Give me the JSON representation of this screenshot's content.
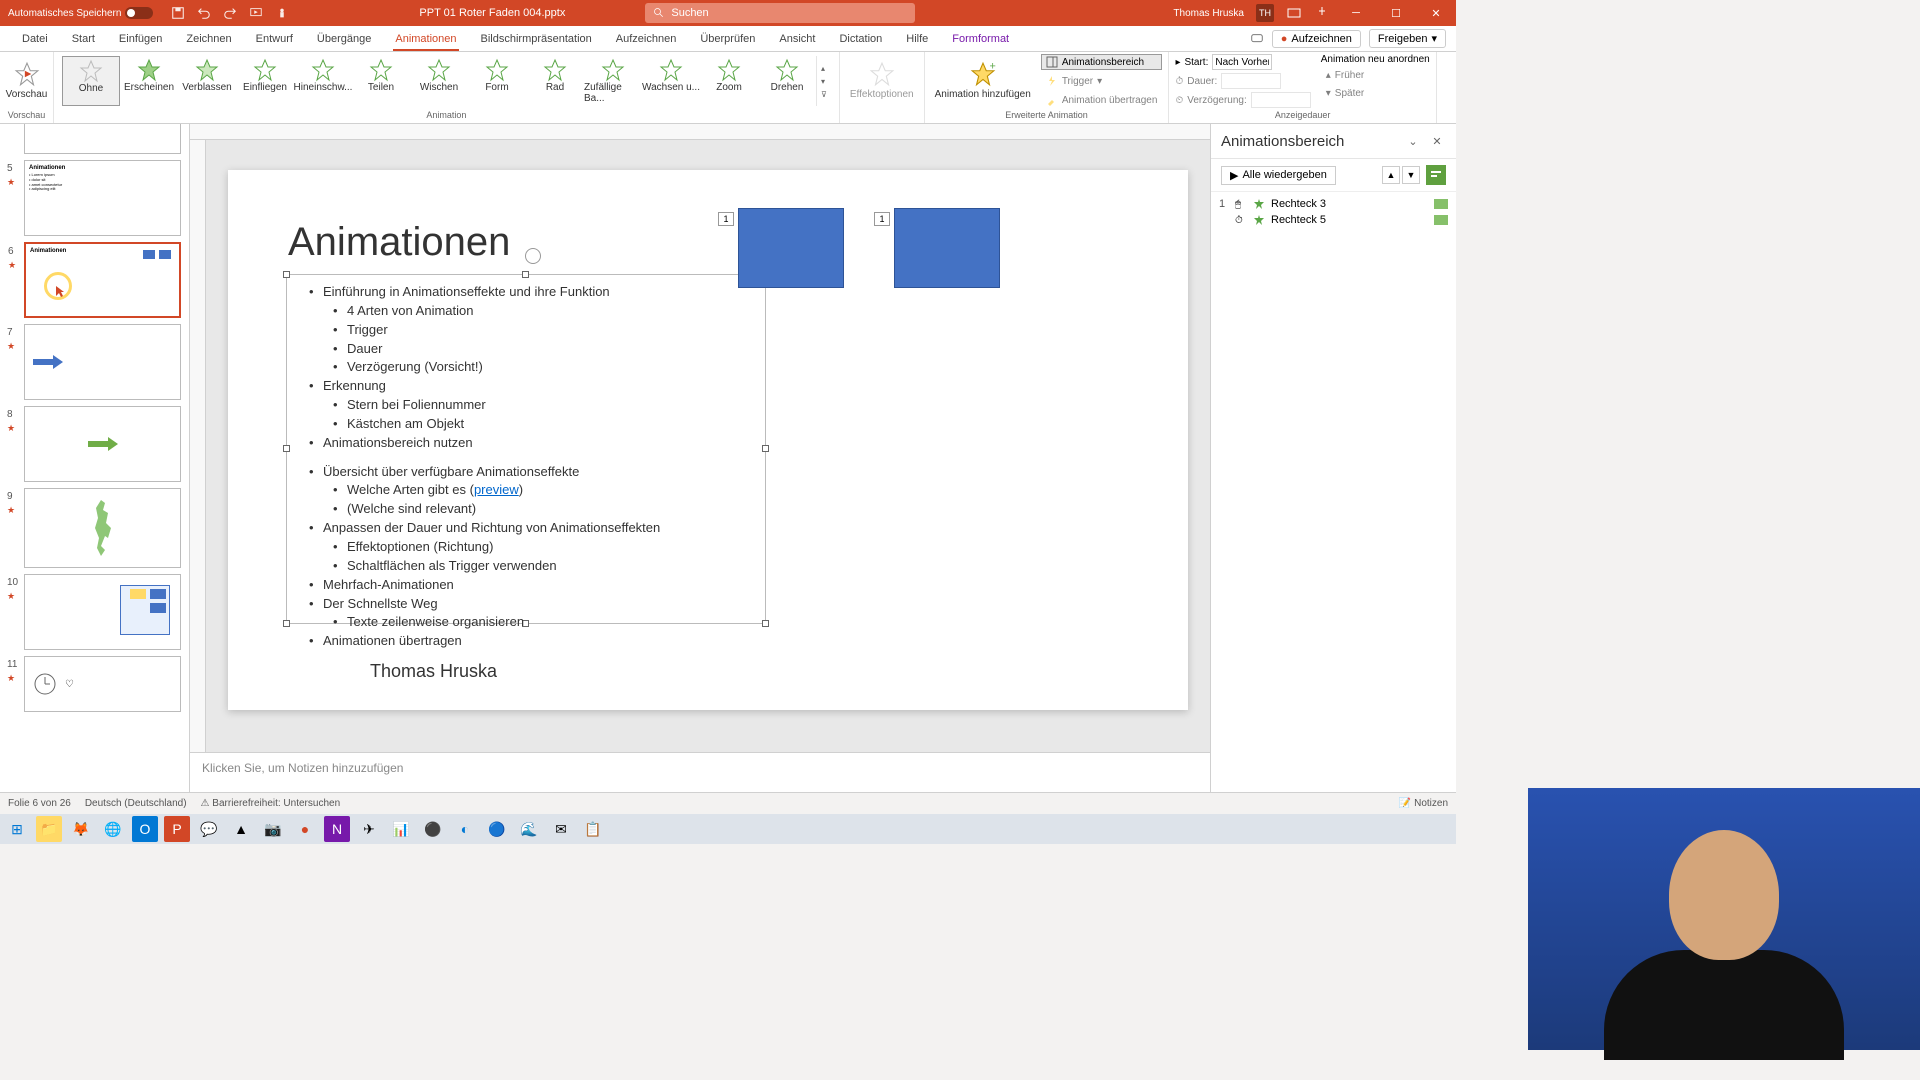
{
  "titlebar": {
    "autosave_label": "Automatisches Speichern",
    "filename": "PPT 01 Roter Faden 004.pptx",
    "search_placeholder": "Suchen",
    "user": "Thomas Hruska",
    "user_initials": "TH"
  },
  "tabs": {
    "datei": "Datei",
    "start": "Start",
    "einfuegen": "Einfügen",
    "zeichnen": "Zeichnen",
    "entwurf": "Entwurf",
    "uebergaenge": "Übergänge",
    "animationen": "Animationen",
    "bildschirm": "Bildschirmpräsentation",
    "aufzeichnen": "Aufzeichnen",
    "ueberpruefen": "Überprüfen",
    "ansicht": "Ansicht",
    "dictation": "Dictation",
    "hilfe": "Hilfe",
    "formformat": "Formformat",
    "record_btn": "Aufzeichnen",
    "share_btn": "Freigeben"
  },
  "ribbon": {
    "vorschau": "Vorschau",
    "vorschau_group": "Vorschau",
    "animations": [
      "Ohne",
      "Erscheinen",
      "Verblassen",
      "Einfliegen",
      "Hineinschw...",
      "Teilen",
      "Wischen",
      "Form",
      "Rad",
      "Zufällige Ba...",
      "Wachsen u...",
      "Zoom",
      "Drehen"
    ],
    "animation_group": "Animation",
    "effektoptionen": "Effektoptionen",
    "hinzufuegen": "Animation hinzufügen",
    "animationsbereich": "Animationsbereich",
    "trigger": "Trigger",
    "uebertragen": "Animation übertragen",
    "erweiterte": "Erweiterte Animation",
    "start_lbl": "Start:",
    "start_val": "Nach Vorher...",
    "dauer_lbl": "Dauer:",
    "verzoegerung_lbl": "Verzögerung:",
    "neu_anordnen": "Animation neu anordnen",
    "frueher": "Früher",
    "spaeter": "Später",
    "anzeigedauer": "Anzeigedauer"
  },
  "slide": {
    "title": "Animationen",
    "bullets": [
      {
        "t": "Einführung in Animationseffekte und ihre Funktion",
        "l": 0
      },
      {
        "t": "4 Arten von Animation",
        "l": 1
      },
      {
        "t": "Trigger",
        "l": 1
      },
      {
        "t": "Dauer",
        "l": 1
      },
      {
        "t": "Verzögerung (Vorsicht!)",
        "l": 1
      },
      {
        "t": "Erkennung",
        "l": 0
      },
      {
        "t": "Stern bei Foliennummer",
        "l": 1
      },
      {
        "t": "Kästchen am Objekt",
        "l": 1
      },
      {
        "t": "Animationsbereich nutzen",
        "l": 0
      }
    ],
    "bullets2": [
      {
        "t": "Übersicht über verfügbare Animationseffekte",
        "l": 0
      },
      {
        "pre": "Welche Arten gibt es (",
        "link": "preview",
        "post": ")",
        "l": 1
      },
      {
        "t": "(Welche sind relevant)",
        "l": 1
      },
      {
        "t": "Anpassen der Dauer und Richtung von Animationseffekten",
        "l": 0
      },
      {
        "t": "Effektoptionen (Richtung)",
        "l": 1
      },
      {
        "t": "Schaltflächen als Trigger verwenden",
        "l": 1
      },
      {
        "t": "Mehrfach-Animationen",
        "l": 0
      },
      {
        "t": "Der Schnellste Weg",
        "l": 0
      },
      {
        "t": "Texte zeilenweise organisieren",
        "l": 1
      },
      {
        "t": "Animationen übertragen",
        "l": 0
      }
    ],
    "tag1": "1",
    "tag2": "1",
    "author": "Thomas Hruska"
  },
  "thumbs": [
    5,
    6,
    7,
    8,
    9,
    10,
    11
  ],
  "notes": "Klicken Sie, um Notizen hinzuzufügen",
  "anim_pane": {
    "title": "Animationsbereich",
    "play": "Alle wiedergeben",
    "items": [
      {
        "num": "1",
        "trigger": "mouse",
        "name": "Rechteck 3",
        "color": "#86c06a"
      },
      {
        "num": "",
        "trigger": "clock",
        "name": "Rechteck 5",
        "color": "#86c06a"
      }
    ]
  },
  "status": {
    "slide_of": "Folie 6 von 26",
    "lang": "Deutsch (Deutschland)",
    "access": "Barrierefreiheit: Untersuchen",
    "notizen": "Notizen"
  },
  "colors": {
    "accent": "#d24726",
    "star_green": "#5aa646",
    "star_gray": "#b8b8b8",
    "rect": "#4472c4"
  }
}
